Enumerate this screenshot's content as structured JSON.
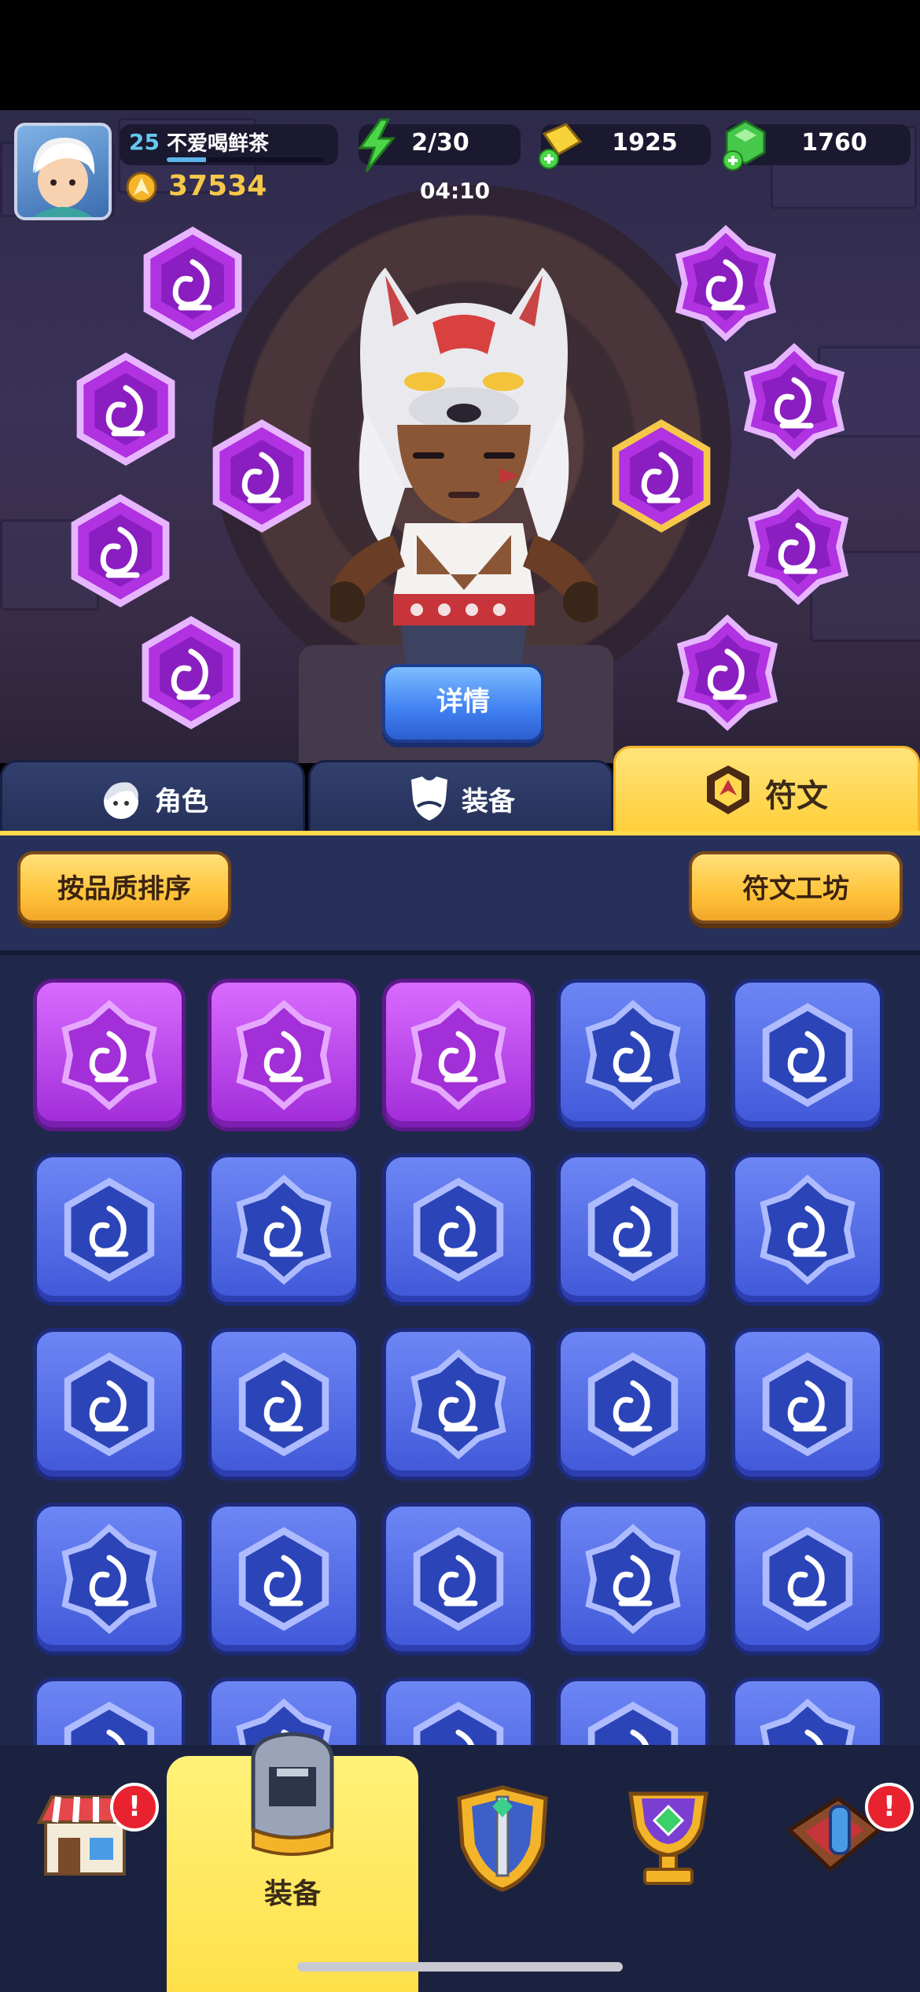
{
  "header": {
    "level": "25",
    "player_name": "不爱喝鲜茶",
    "xp_fraction": 0.25,
    "power": "37534",
    "energy": "2/30",
    "energy_timer": "04:10",
    "gold": "1925",
    "gems": "1760"
  },
  "hero": {
    "details_label": "详情",
    "equipped_rune_icons": [
      "crit-double-icon",
      "bow-up-icon",
      "fireball-icon",
      "ring-up-icon",
      "ghost-bat-icon",
      "potion-arrow-icon",
      "clock-arrow-icon",
      "shield-up-icon",
      "orb-icon",
      "skull-fire-icon"
    ]
  },
  "tabs": [
    {
      "label": "角色",
      "icon": "character-icon"
    },
    {
      "label": "装备",
      "icon": "armor-icon"
    },
    {
      "label": "符文",
      "icon": "rune-icon",
      "active": true
    }
  ],
  "actions": {
    "sort_label": "按品质排序",
    "workshop_label": "符文工坊"
  },
  "runes": [
    {
      "rarity": "epic",
      "icon": "slash-fire-icon"
    },
    {
      "rarity": "epic",
      "icon": "flame-circle-icon"
    },
    {
      "rarity": "epic",
      "icon": "triple-flame-icon"
    },
    {
      "rarity": "rare",
      "icon": "spike-ball-icon"
    },
    {
      "rarity": "rare",
      "icon": "swirl-icon"
    },
    {
      "rarity": "rare",
      "icon": "demon-head-icon"
    },
    {
      "rarity": "rare",
      "icon": "demon-head-icon"
    },
    {
      "rarity": "rare",
      "icon": "boomerang-icon"
    },
    {
      "rarity": "rare",
      "icon": "fire-splash-icon"
    },
    {
      "rarity": "rare",
      "icon": "fire-splash-icon"
    },
    {
      "rarity": "rare",
      "icon": "crown-shield-icon"
    },
    {
      "rarity": "rare",
      "icon": "ice-shard-icon"
    },
    {
      "rarity": "rare",
      "icon": "cauldron-icon"
    },
    {
      "rarity": "rare",
      "icon": "clock-arrow-icon"
    },
    {
      "rarity": "rare",
      "icon": "potion-arrow-icon"
    },
    {
      "rarity": "rare",
      "icon": "arrow-rain-icon"
    },
    {
      "rarity": "rare",
      "icon": "fire-ring-icon"
    },
    {
      "rarity": "rare",
      "icon": "skull-fire-icon"
    },
    {
      "rarity": "rare",
      "icon": "skull-fire-icon"
    },
    {
      "rarity": "rare",
      "icon": "snowflake-icon"
    },
    {
      "rarity": "rare",
      "icon": "shield-icon"
    },
    {
      "rarity": "rare",
      "icon": "up-arrow-icon"
    },
    {
      "rarity": "rare",
      "icon": "hand-icon"
    },
    {
      "rarity": "rare",
      "icon": "target-icon"
    },
    {
      "rarity": "rare",
      "icon": "star-icon"
    }
  ],
  "bottom_nav": [
    {
      "name": "shop",
      "icon": "shop-icon",
      "badge": "!"
    },
    {
      "name": "equipment",
      "icon": "helmet-icon",
      "label": "装备",
      "active": true
    },
    {
      "name": "battle",
      "icon": "sword-shield-icon"
    },
    {
      "name": "trophy",
      "icon": "trophy-icon"
    },
    {
      "name": "events",
      "icon": "chest-icon",
      "badge": "!"
    }
  ]
}
